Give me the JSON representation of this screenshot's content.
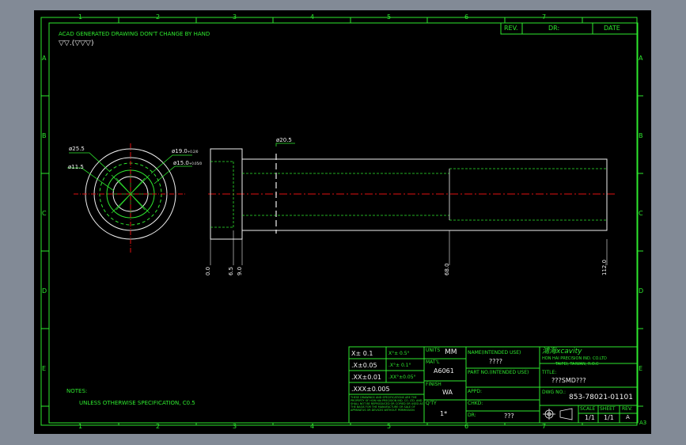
{
  "header_note": "ACAD GENERATED DRAWING DON'T CHANGE BY HAND",
  "surface_symbols": "▽▽.(▽▽▽)",
  "revision_block": {
    "rev": "REV.",
    "dr": "DR:",
    "date": "DATE"
  },
  "zones_columns": [
    "1",
    "2",
    "3",
    "4",
    "5",
    "6",
    "7"
  ],
  "zones_rows": [
    "A",
    "B",
    "C",
    "D",
    "E"
  ],
  "dims": {
    "d_outer": "ø25.5",
    "d_inner": "ø11.5",
    "d_190": "ø19.0",
    "d_190_tol": "+0.2/0",
    "d_150": "ø15.0",
    "d_150_tol": "+0.05/0",
    "d_shaft": "ø20.5",
    "x_0": "0.0",
    "x_65": "6.5",
    "x_90": "9.0",
    "x_680": "68.0",
    "x_1120": "112.0"
  },
  "notes": {
    "label": "NOTES:",
    "line1": "UNLESS OTHERWISE SPECIFICATION, C0.5"
  },
  "tolerances": {
    "x0": "X± 0.1",
    "x0a": "X°± 0.5°",
    "x1": ".X±0.05",
    "x1a": ".X°± 0.1°",
    "x2": ".XX±0.01",
    "x2a": ".XX°±0.05°",
    "x3": ".XXX±0.005"
  },
  "fine_print": "THESE DRAWINGS AND SPECIFICATIONS ARE THE PROPERTY OF HON HAI PRECISION IND. CO. LTD. AND SHALL NOT BE REPRODUCED OR COPIED OR USED AS THE BASIS FOR THE MANUFACTURE OR SALE OF APPARATUS OR DEVICES WITHOUT PERMISSION",
  "title_block": {
    "units_label": "UNITS",
    "units_value": "MM",
    "matl_label": "MAT'L",
    "matl_value": "A6061",
    "finish_label": "FINISH",
    "finish_value": "WA",
    "qty_label": "Q'TY",
    "qty_value": "1*",
    "name_label": "NAME(INTENDED USE)",
    "name_value": "????",
    "partno_label": "PART NO.(INTENDED USE)",
    "appd_label": "APPD:",
    "chkd_label": "CHKD:",
    "dr_label": "DR:",
    "dr_value": "???",
    "company_logo": "鴻海xcavity",
    "company_name": "HON HAI PRECISION IND. CO.LTD",
    "company_addr": "TAIPEI, TAIWAN, R.O.C",
    "title_label": "TITLE:",
    "title_value": "???SMD???",
    "dwg_label": "DWG NO.:",
    "dwg_value": "853-78021-01101",
    "scale_label": "SCALE",
    "scale_value": "1/1",
    "sheet_label": "SHEET",
    "sheet_value": "1/1",
    "rev_label": "REV.",
    "rev_value": "A",
    "size": "A3"
  },
  "colors": {
    "sheet": "#000000",
    "frame": "#2ee82e",
    "part": "#f0f0f0",
    "center": "#e01010"
  }
}
